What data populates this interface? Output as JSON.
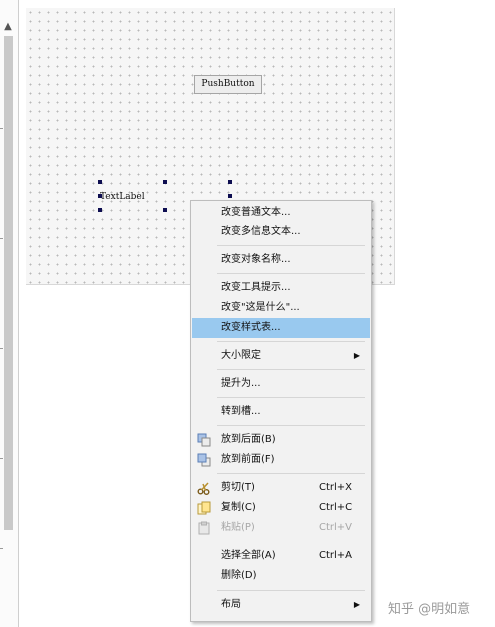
{
  "canvas": {
    "pushbutton_label": "PushButton",
    "textlabel_label": "TextLabel"
  },
  "context_menu": {
    "items": [
      {
        "label": "改变普通文本..."
      },
      {
        "label": "改变多信息文本..."
      },
      {
        "label": "改变对象名称..."
      },
      {
        "label": "改变工具提示..."
      },
      {
        "label": "改变\"这是什么\"..."
      },
      {
        "label": "改变样式表...",
        "highlighted": true
      },
      {
        "label": "大小限定",
        "submenu": true
      },
      {
        "label": "提升为..."
      },
      {
        "label": "转到槽..."
      },
      {
        "label": "放到后面(B)",
        "icon": "send-to-back-icon"
      },
      {
        "label": "放到前面(F)",
        "icon": "bring-to-front-icon"
      },
      {
        "label": "剪切(T)",
        "shortcut": "Ctrl+X",
        "icon": "cut-icon"
      },
      {
        "label": "复制(C)",
        "shortcut": "Ctrl+C",
        "icon": "copy-icon"
      },
      {
        "label": "粘贴(P)",
        "shortcut": "Ctrl+V",
        "icon": "paste-icon",
        "disabled": true
      },
      {
        "label": "选择全部(A)",
        "shortcut": "Ctrl+A"
      },
      {
        "label": "删除(D)"
      },
      {
        "label": "布局",
        "submenu": true
      }
    ]
  },
  "watermark": "知乎 @明如意",
  "colors": {
    "highlight": "#99c9ef",
    "handle": "#0d0d50",
    "menu_bg": "#f2f2f2"
  }
}
